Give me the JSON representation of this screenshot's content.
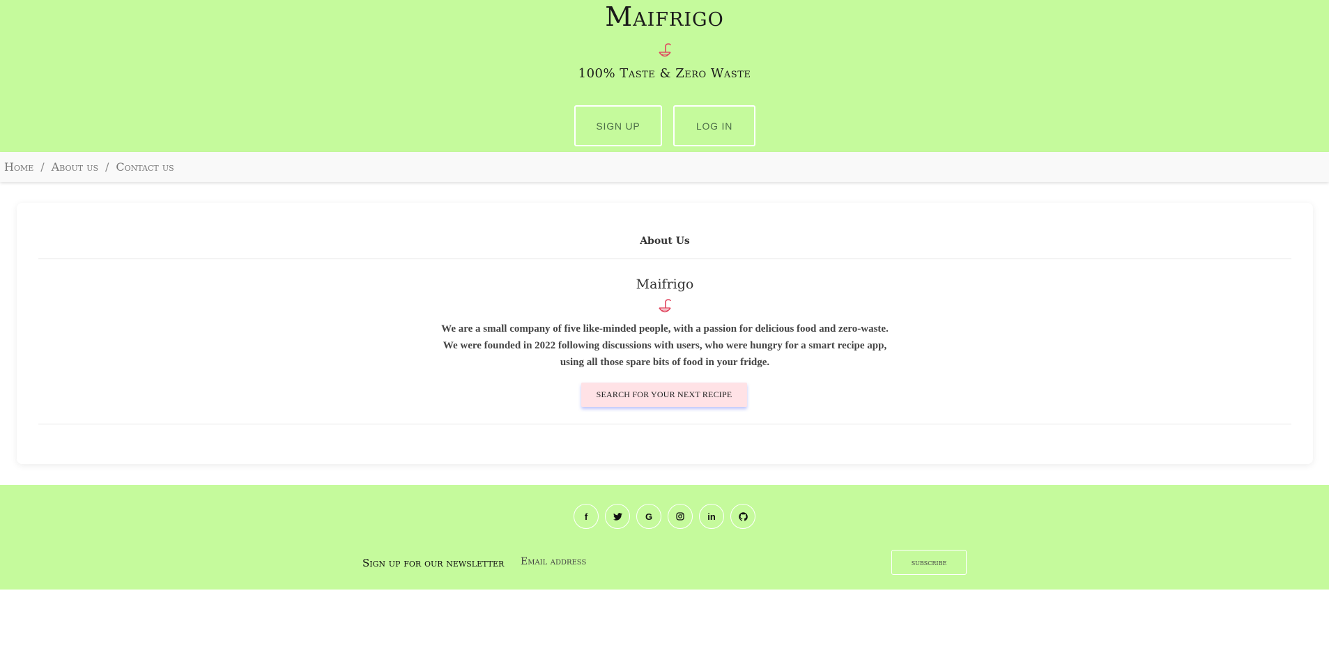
{
  "header": {
    "title": "Maifrigo",
    "tagline": "100% Taste & Zero Waste",
    "signup_label": "SIGN UP",
    "login_label": "LOG IN",
    "background_color": "#c5fa9c",
    "icon": "ladle-bowl-icon"
  },
  "breadcrumb": {
    "items": [
      "Home",
      "About us",
      "Contact us"
    ],
    "separator": "/"
  },
  "about": {
    "heading": "About Us",
    "brand": "Maifrigo",
    "icon": "ladle-bowl-icon",
    "icon_color": "#e0455e",
    "paragraph_lines": [
      "We are a small company of five like-minded people, with a passion for delicious food and zero-waste.",
      "We were founded in 2022 following discussions with users, who were hungry for a smart recipe app,",
      "using all those spare bits of food in your fridge."
    ],
    "cta_label": "SEARCH FOR YOUR NEXT RECIPE",
    "cta_color": "#ffe2e6"
  },
  "footer": {
    "social": [
      {
        "name": "facebook-icon",
        "glyph": "f"
      },
      {
        "name": "twitter-icon",
        "glyph": "🐦"
      },
      {
        "name": "google-icon",
        "glyph": "G"
      },
      {
        "name": "instagram-icon",
        "glyph": "◎"
      },
      {
        "name": "linkedin-icon",
        "glyph": "in"
      },
      {
        "name": "github-icon",
        "glyph": "⌥"
      }
    ],
    "newsletter_label": "Sign up for our newsletter",
    "email_placeholder": "Email address",
    "subscribe_label": "subscribe"
  }
}
